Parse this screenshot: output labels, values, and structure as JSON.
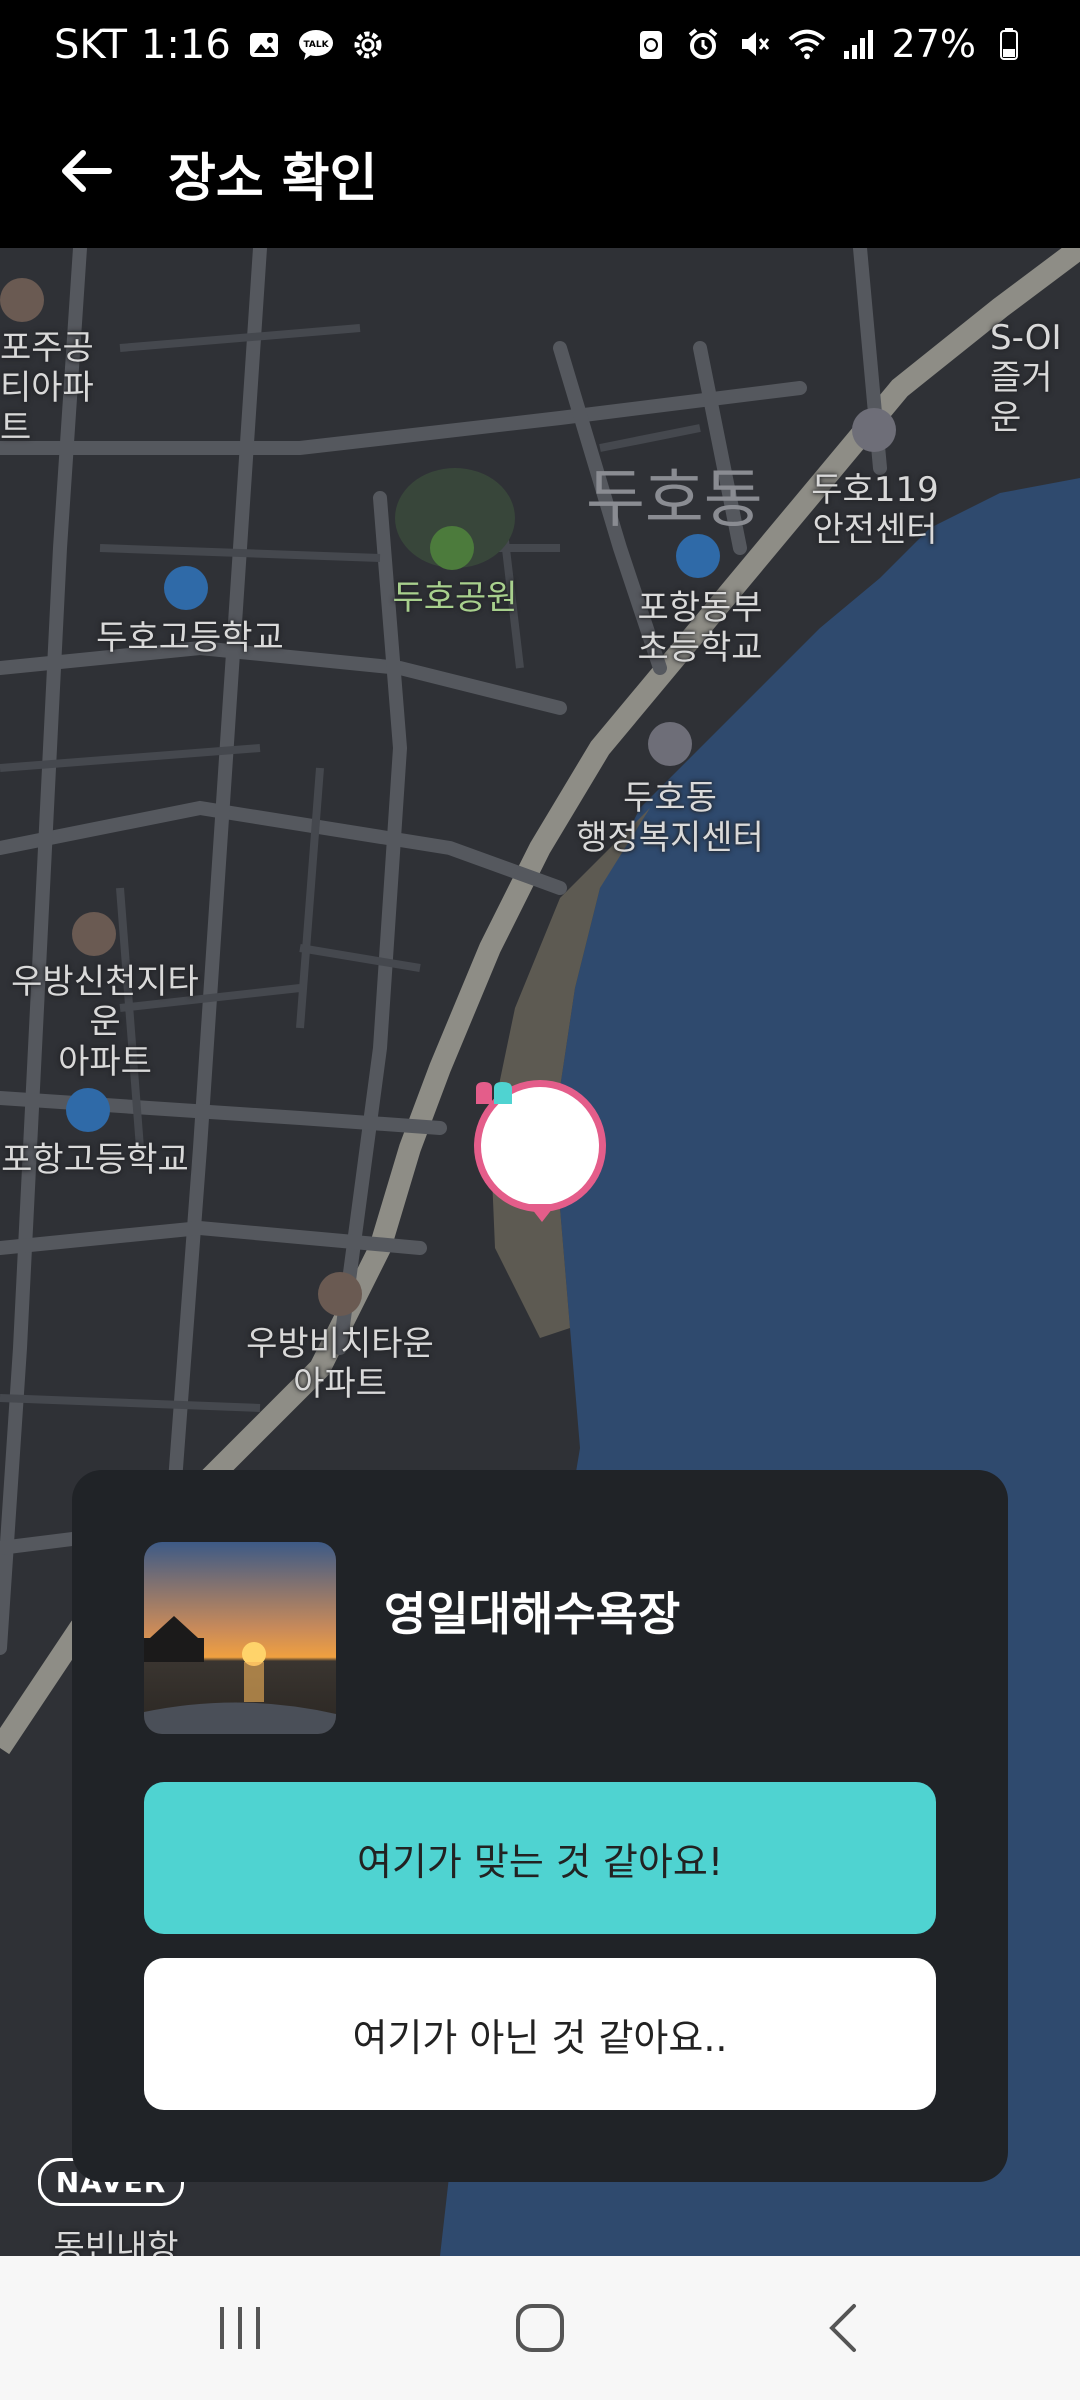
{
  "status_bar": {
    "carrier": "SKT",
    "time": "1:16",
    "battery": "27%"
  },
  "app_bar": {
    "title": "장소 확인"
  },
  "map": {
    "district_label": "두호동",
    "pois": [
      {
        "label": "포주공\n티아파트"
      },
      {
        "label": "두호공원"
      },
      {
        "label": "두호고등학교"
      },
      {
        "label": "포항동부\n초등학교"
      },
      {
        "label": "두호119\n안전센터"
      },
      {
        "label": "두호동\n행정복지센터"
      },
      {
        "label": "우방신천지타운\n아파트"
      },
      {
        "label": "포항고등학교"
      },
      {
        "label": "우방비치타운\n아파트"
      },
      {
        "label": "S-OI\n즐거운"
      },
      {
        "label": "동빈내항"
      }
    ],
    "provider_logo": "NAVER"
  },
  "place_card": {
    "name": "영일대해수욕장",
    "confirm_label": "여기가 맞는 것 같아요!",
    "reject_label": "여기가 아닌 것 같아요..",
    "confirm_color": "#4fd3d1",
    "marker_color": "#e45d8a"
  },
  "nav_bar": {
    "icons": [
      "recent-apps-icon",
      "home-icon",
      "back-icon"
    ]
  }
}
